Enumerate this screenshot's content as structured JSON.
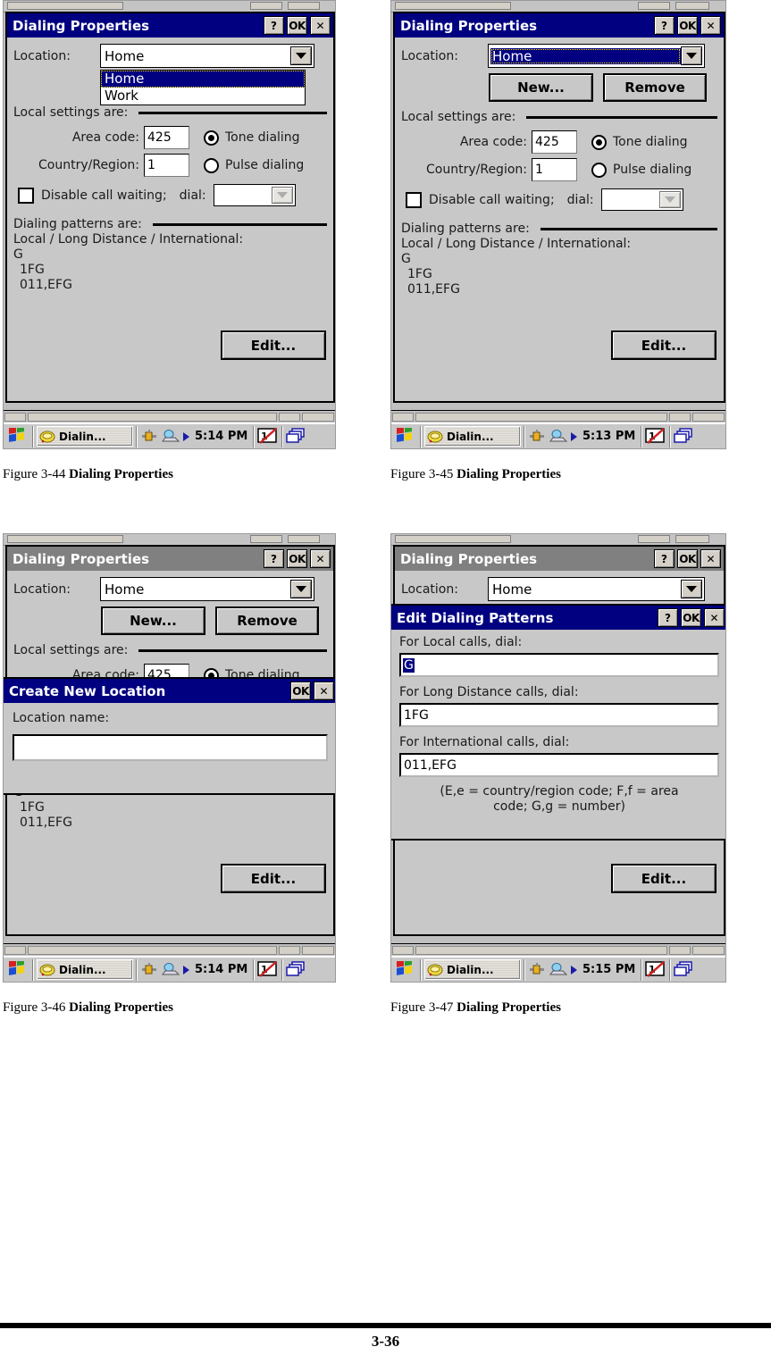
{
  "page": {
    "number": "3-36"
  },
  "figures": [
    {
      "id": "fig-3-44",
      "caption_number": "Figure 3-44 ",
      "caption_title": "Dialing Properties",
      "window_title": "Dialing Properties",
      "title_active": true,
      "taskbar": {
        "task_label": "Dialin...",
        "time": "5:14 PM"
      }
    },
    {
      "id": "fig-3-45",
      "caption_number": "Figure 3-45 ",
      "caption_title": "Dialing Properties",
      "window_title": "Dialing Properties",
      "title_active": true,
      "taskbar": {
        "task_label": "Dialin...",
        "time": "5:13 PM"
      }
    },
    {
      "id": "fig-3-46",
      "caption_number": "Figure 3-46 ",
      "caption_title": "Dialing Properties",
      "window_title": "Dialing Properties",
      "title_active": false,
      "taskbar": {
        "task_label": "Dialin...",
        "time": "5:14 PM"
      }
    },
    {
      "id": "fig-3-47",
      "caption_number": "Figure 3-47 ",
      "caption_title": "Dialing Properties",
      "window_title": "Dialing Properties",
      "title_active": false,
      "taskbar": {
        "task_label": "Dialin...",
        "time": "5:15 PM"
      }
    }
  ],
  "titlebar_buttons": {
    "help": "?",
    "ok": "OK",
    "close": "✕"
  },
  "dialing_properties": {
    "location_label": "Location:",
    "location_value": "Home",
    "location_options": [
      "Home",
      "Work"
    ],
    "location_highlighted": "Home",
    "new_button": "New...",
    "remove_button": "Remove",
    "local_settings_label": "Local settings are:",
    "area_code_label": "Area code:",
    "area_code_value": "425",
    "country_label": "Country/Region:",
    "country_value": "1",
    "tone_label": "Tone dialing",
    "pulse_label": "Pulse dialing",
    "tone_selected": true,
    "pulse_selected": false,
    "disable_call_waiting_label": "Disable call waiting;",
    "disable_call_waiting_checked": false,
    "dial_label": "dial:",
    "dial_value": "",
    "dialing_patterns_label": "Dialing patterns are:",
    "patterns_header": "Local / Long Distance / International:",
    "pattern_local": "G",
    "pattern_long_distance": "1FG",
    "pattern_international": "011,EFG",
    "edit_button": "Edit..."
  },
  "create_new_location": {
    "window_title": "Create New Location",
    "location_name_label": "Location name:",
    "location_name_value": "",
    "ok_button": "OK",
    "close_button": "✕"
  },
  "edit_dialing_patterns": {
    "window_title": "Edit Dialing Patterns",
    "local_label": "For Local calls, dial:",
    "local_value": "G",
    "local_selected": true,
    "long_distance_label": "For Long Distance calls, dial:",
    "long_distance_value": "1FG",
    "international_label": "For International calls, dial:",
    "international_value": "011,EFG",
    "hint_line1": "(E,e = country/region code; F,f = area",
    "hint_line2": "code; G,g = number)",
    "help_button": "?",
    "ok_button": "OK",
    "close_button": "✕"
  },
  "colors": {
    "title_active": "#000080",
    "title_inactive": "#808080",
    "dialog_face": "#c8c8c8",
    "field_white": "#ffffff",
    "selection": "#000080"
  }
}
